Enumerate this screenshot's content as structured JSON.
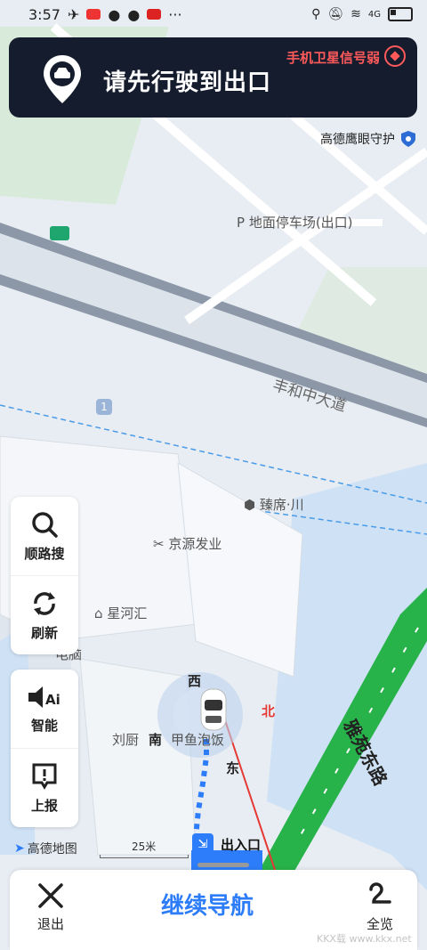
{
  "status": {
    "time": "3:57",
    "more": "···",
    "network": "4G"
  },
  "banner": {
    "title": "请先行驶到出口",
    "gps": "手机卫星信号弱"
  },
  "guard": {
    "label": "高德鹰眼守护"
  },
  "map": {
    "parking": "地面停车场(出口)",
    "road_main": "丰和中大道",
    "road_side": "雅苑东路",
    "poi_1": "臻席·川",
    "poi_2": "京源发业",
    "poi_3": "星河汇",
    "poi_4": "刘厨",
    "poi_5": "甲鱼泡饭",
    "poi_6": "电脑",
    "marker_1": "1",
    "exit_label": "出入口"
  },
  "compass": {
    "west": "西",
    "north": "北",
    "south": "南",
    "east": "东"
  },
  "panel": {
    "search": "顺路搜",
    "refresh": "刷新",
    "smart": "智能",
    "report": "上报"
  },
  "brand": {
    "logo": "高德地图",
    "scale": "25米"
  },
  "bottom": {
    "exit": "退出",
    "continue": "继续导航",
    "overview": "全览"
  },
  "watermark": "KKX载 www.kkx.net",
  "colors": {
    "accent": "#2d7dfa",
    "banner_bg": "#151c2e",
    "warning": "#ff5a5a",
    "road_green": "#27b34a"
  }
}
